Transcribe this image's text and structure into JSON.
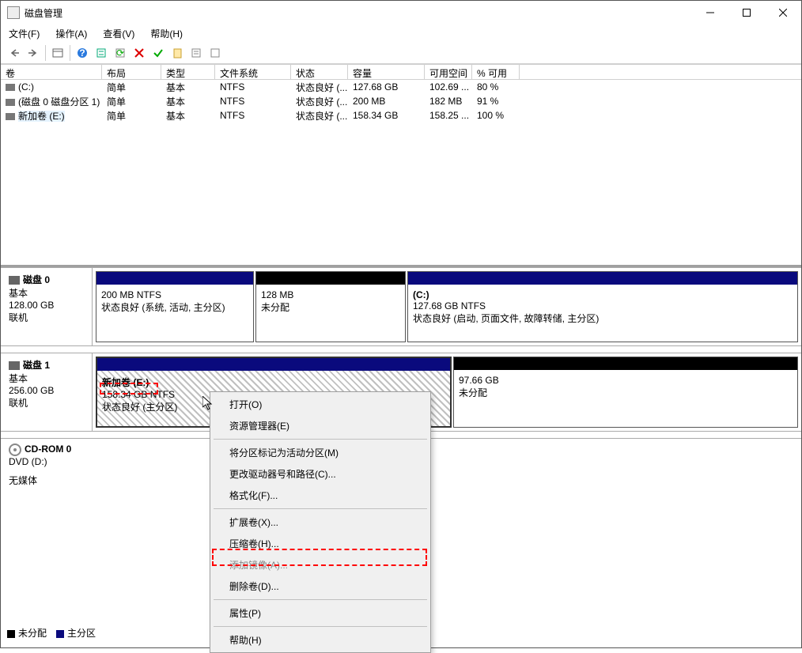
{
  "window": {
    "title": "磁盘管理"
  },
  "menu": {
    "file": "文件(F)",
    "action": "操作(A)",
    "view": "查看(V)",
    "help": "帮助(H)"
  },
  "columns": {
    "volume": "卷",
    "layout": "布局",
    "type": "类型",
    "fs": "文件系统",
    "status": "状态",
    "capacity": "容量",
    "free": "可用空间",
    "pct": "% 可用"
  },
  "volumes": [
    {
      "name": "(C:)",
      "layout": "简单",
      "type": "基本",
      "fs": "NTFS",
      "status": "状态良好 (...",
      "capacity": "127.68 GB",
      "free": "102.69 ...",
      "pct": "80 %"
    },
    {
      "name": "(磁盘 0 磁盘分区 1)",
      "layout": "简单",
      "type": "基本",
      "fs": "NTFS",
      "status": "状态良好 (...",
      "capacity": "200 MB",
      "free": "182 MB",
      "pct": "91 %"
    },
    {
      "name": "新加卷 (E:)",
      "layout": "简单",
      "type": "基本",
      "fs": "NTFS",
      "status": "状态良好 (...",
      "capacity": "158.34 GB",
      "free": "158.25 ...",
      "pct": "100 %"
    }
  ],
  "disk0": {
    "name": "磁盘 0",
    "type": "基本",
    "size": "128.00 GB",
    "state": "联机",
    "p0": {
      "line1": "200 MB NTFS",
      "line2": "状态良好 (系统, 活动, 主分区)"
    },
    "p1": {
      "line1": "128 MB",
      "line2": "未分配"
    },
    "p2": {
      "name": "(C:)",
      "line1": "127.68 GB NTFS",
      "line2": "状态良好 (启动, 页面文件, 故障转储, 主分区)"
    }
  },
  "disk1": {
    "name": "磁盘 1",
    "type": "基本",
    "size": "256.00 GB",
    "state": "联机",
    "p0": {
      "name": "新加卷  (E:)",
      "line1": "158.34 GB NTFS",
      "line2": "状态良好 (主分区)"
    },
    "p1": {
      "line1": "97.66 GB",
      "line2": "未分配"
    }
  },
  "cdrom": {
    "name": "CD-ROM 0",
    "line1": "DVD (D:)",
    "line2": "无媒体"
  },
  "legend": {
    "unalloc": "未分配",
    "primary": "主分区"
  },
  "ctx": {
    "open": "打开(O)",
    "explorer": "资源管理器(E)",
    "markActive": "将分区标记为活动分区(M)",
    "changeLetter": "更改驱动器号和路径(C)...",
    "format": "格式化(F)...",
    "extend": "扩展卷(X)...",
    "shrink": "压缩卷(H)...",
    "addMirror": "添加镜像(A)...",
    "delete": "删除卷(D)...",
    "properties": "属性(P)",
    "help": "帮助(H)"
  }
}
